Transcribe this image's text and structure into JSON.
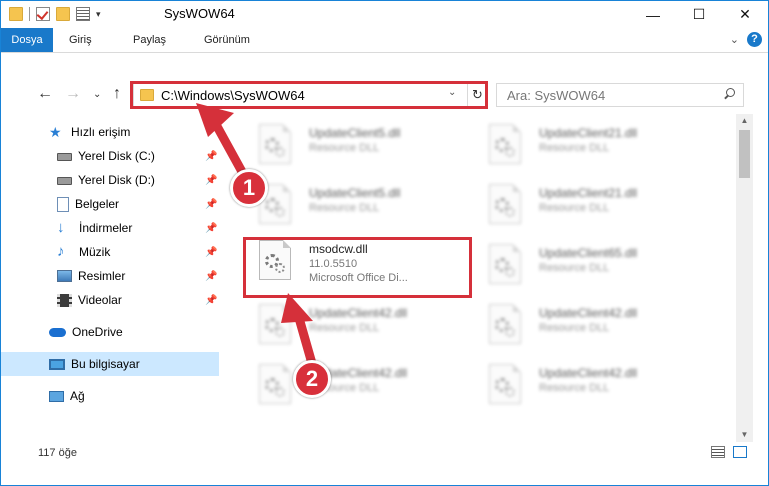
{
  "window": {
    "title": "SysWOW64",
    "minimize_glyph": "—",
    "maximize_glyph": "☐",
    "close_glyph": "✕"
  },
  "ribbon": {
    "tabs": [
      {
        "label": "Dosya"
      },
      {
        "label": "Giriş"
      },
      {
        "label": "Paylaş"
      },
      {
        "label": "Görünüm"
      }
    ],
    "help_glyph": "?",
    "collapse_glyph": "⌄"
  },
  "navigation": {
    "back_glyph": "←",
    "forward_glyph": "→",
    "recent_glyph": "⌄",
    "up_glyph": "↑",
    "address": "C:\\Windows\\SysWOW64",
    "address_dropdown_glyph": "⌄",
    "refresh_glyph": "↻",
    "search_placeholder": "Ara: SysWOW64"
  },
  "sidebar": {
    "quick_access": "Hızlı erişim",
    "items": [
      {
        "label": "Yerel Disk (C:)",
        "icon": "drive-icon"
      },
      {
        "label": "Yerel Disk (D:)",
        "icon": "drive-icon"
      },
      {
        "label": "Belgeler",
        "icon": "documents-icon"
      },
      {
        "label": "İndirmeler",
        "icon": "downloads-icon"
      },
      {
        "label": "Müzik",
        "icon": "music-icon"
      },
      {
        "label": "Resimler",
        "icon": "pictures-icon"
      },
      {
        "label": "Videolar",
        "icon": "videos-icon"
      }
    ],
    "onedrive": "OneDrive",
    "this_pc": "Bu bilgisayar",
    "network": "Ağ",
    "pin_glyph": "📌"
  },
  "files": {
    "left_column": [
      {
        "name": "UpdateClient5.dll",
        "type": "Resource DLL"
      },
      {
        "name": "UpdateClient5.dll",
        "type": "Resource DLL"
      },
      {
        "name": "msodcw.dll",
        "version": "11.0.5510",
        "description": "Microsoft Office Di..."
      },
      {
        "name": "UpdateClient42.dll",
        "type": "Resource DLL"
      },
      {
        "name": "UpdateClient42.dll",
        "type": "Resource DLL"
      }
    ],
    "right_column": [
      {
        "name": "UpdateClient21.dll",
        "type": "Resource DLL"
      },
      {
        "name": "UpdateClient21.dll",
        "type": "Resource DLL"
      },
      {
        "name": "UpdateClient65.dll",
        "type": "Resource DLL"
      },
      {
        "name": "UpdateClient42.dll",
        "type": "Resource DLL"
      },
      {
        "name": "UpdateClient42.dll",
        "type": "Resource DLL"
      }
    ]
  },
  "status_bar": {
    "item_count": "117 öğe"
  },
  "annotations": {
    "callout_1": "1",
    "callout_2": "2",
    "accent_color": "#d5303a"
  }
}
